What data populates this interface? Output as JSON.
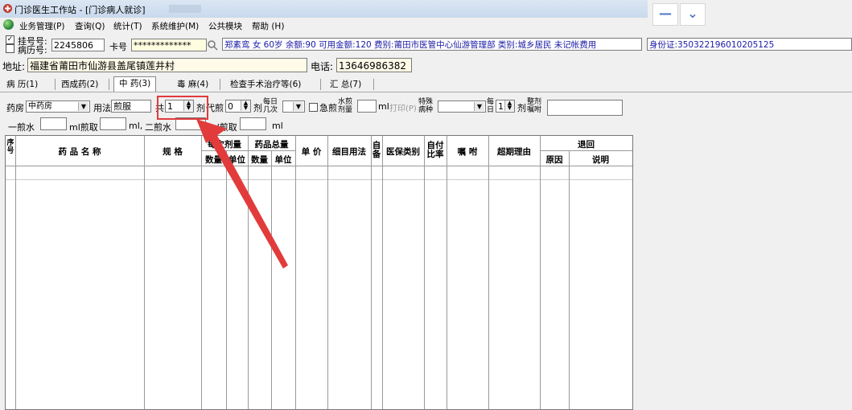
{
  "window": {
    "title": "门诊医生工作站 - [门诊病人就诊]"
  },
  "menu": [
    "业务管理(P)",
    "查询(Q)",
    "统计(T)",
    "系统维护(M)",
    "公共模块",
    "帮助 (H)"
  ],
  "win_buttons": {
    "minimize": "—",
    "dropdown": "⌄"
  },
  "patient": {
    "reg_label": "挂号号:",
    "record_label": "病历号:",
    "record_no": "2245806",
    "card_label": "卡号",
    "card_no": "*************",
    "info": "郑素鸾 女 60岁 余额:90 可用金额:120 费别:莆田市医管中心仙游管理部 类别:城乡居民 未记帐费用",
    "id_card": "身份证:350322196010205125",
    "addr_label": "地址:",
    "address": "福建省莆田市仙游县盖尾镇莲井村",
    "phone_label": "电话:",
    "phone": "13646986382"
  },
  "tabs": [
    "病 历(1)",
    "西成药(2)",
    "中 药(3)",
    "毒 麻(4)",
    "检查手术治疗等(6)",
    "汇 总(7)"
  ],
  "tcm": {
    "pharmacy_label": "药房",
    "pharmacy": "中药房",
    "usage_label": "用法",
    "usage": "煎服",
    "total_label": "共",
    "total": "1",
    "dose_unit": "剂",
    "decoct_label": "代煎",
    "decoct": "0",
    "dose_unit2": "剂",
    "per_day_label1": "每日",
    "per_day_label2": "几次",
    "urgent_label": "急煎",
    "water_label1": "水煎",
    "water_label2": "剂量",
    "ml": "ml",
    "print_label": "打印(P)",
    "special_label1": "特殊",
    "special_label2": "病种",
    "daily_label1": "每",
    "daily_label2": "日",
    "daily": "1",
    "dose_unit3": "剂",
    "advice_label1": "整剂",
    "advice_label2": "嘱咐",
    "first_water": "一煎水",
    "ml_take": "ml煎取",
    "ml_comma": "ml,",
    "second_water": "二煎水",
    "ml_take2": "ml煎取",
    "ml_end": "ml"
  },
  "grid": {
    "col_seq": "序号",
    "col_name": "药 品 名 称",
    "col_spec": "规  格",
    "col_dose": "每次剂量",
    "col_total": "药品总量",
    "qty": "数量",
    "unit": "单位",
    "qty2": "数量",
    "unit2": "单位",
    "col_price": "单 价",
    "col_usage": "细目用法",
    "col_self": "自备",
    "col_insurance": "医保类别",
    "col_ratio": "自付比率",
    "col_advice": "嘱 咐",
    "col_overdue": "超期理由",
    "col_return": "退回",
    "reason": "原因",
    "note": "说明"
  },
  "colors": {
    "highlight": "#e23b3b",
    "info_text": "#1a1aa6"
  }
}
